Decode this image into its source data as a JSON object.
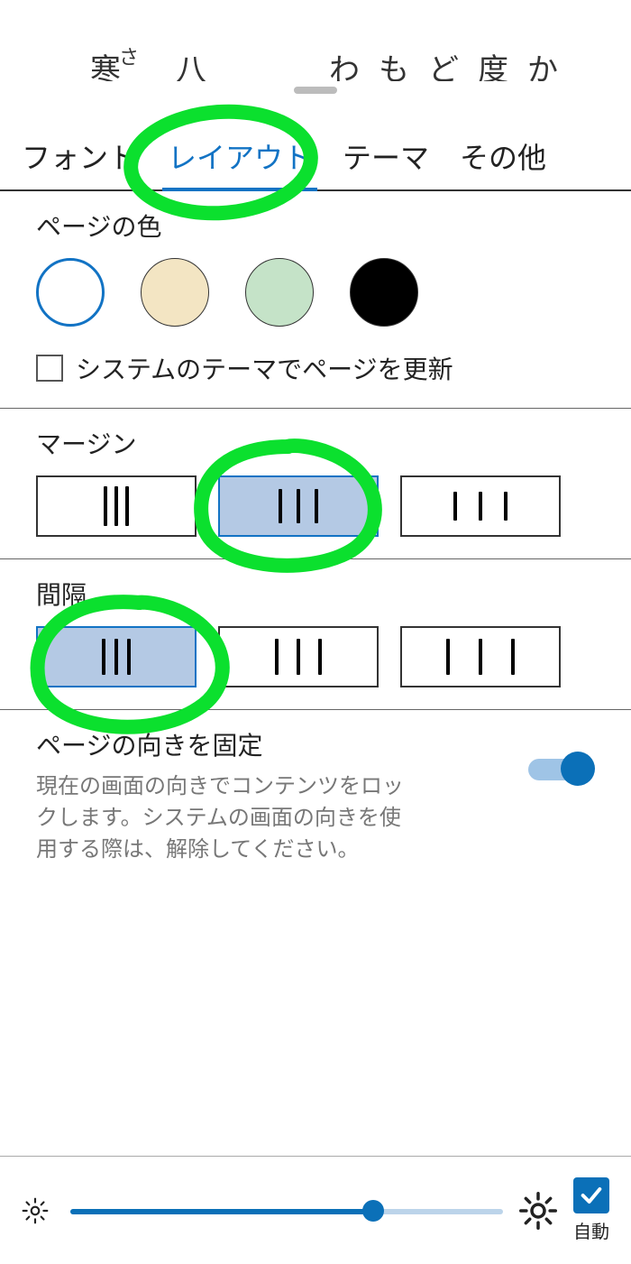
{
  "top_chars": [
    "寒",
    "さ",
    "八",
    "わ",
    "も",
    "ど",
    "度",
    "か"
  ],
  "tabs": {
    "items": [
      {
        "label": "フォント"
      },
      {
        "label": "レイアウト"
      },
      {
        "label": "テーマ"
      },
      {
        "label": "その他"
      }
    ],
    "active_index": 1
  },
  "page_color": {
    "label": "ページの色",
    "swatches": [
      {
        "color": "#ffffff",
        "selected": true
      },
      {
        "color": "#f3e5c3",
        "selected": false
      },
      {
        "color": "#c5e3c8",
        "selected": false
      },
      {
        "color": "#000000",
        "selected": false
      }
    ],
    "system_theme_label": "システムのテーマでページを更新",
    "system_theme_checked": false
  },
  "margin": {
    "label": "マージン",
    "selected_index": 1
  },
  "spacing": {
    "label": "間隔",
    "selected_index": 0
  },
  "orientation_lock": {
    "title": "ページの向きを固定",
    "description": "現在の画面の向きでコンテンツをロックします。システムの画面の向きを使用する際は、解除してください。",
    "on": true
  },
  "brightness": {
    "value_percent": 70,
    "auto_label": "自動",
    "auto_checked": true
  },
  "annotation_color": "#0be02e"
}
